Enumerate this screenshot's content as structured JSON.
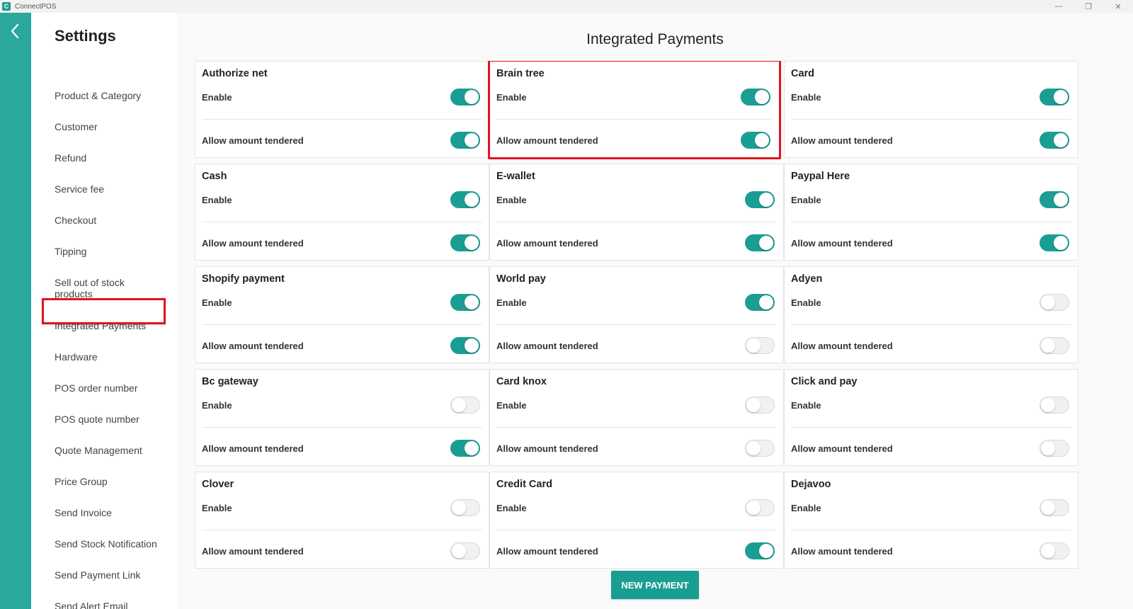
{
  "window": {
    "app_title": "ConnectPOS",
    "app_icon_letter": "C",
    "minimize": "—",
    "restore": "❐",
    "close": "✕"
  },
  "sidebar": {
    "title": "Settings",
    "items": [
      {
        "label": "Product & Category"
      },
      {
        "label": "Customer"
      },
      {
        "label": "Refund"
      },
      {
        "label": "Service fee"
      },
      {
        "label": "Checkout"
      },
      {
        "label": "Tipping"
      },
      {
        "label": "Sell out of stock products"
      },
      {
        "label": "Integrated Payments",
        "active": true
      },
      {
        "label": "Hardware"
      },
      {
        "label": "POS order number"
      },
      {
        "label": "POS quote number"
      },
      {
        "label": "Quote Management"
      },
      {
        "label": "Price Group"
      },
      {
        "label": "Send Invoice"
      },
      {
        "label": "Send Stock Notification"
      },
      {
        "label": "Send Payment Link"
      },
      {
        "label": "Send Alert Email"
      }
    ]
  },
  "main": {
    "title": "Integrated Payments",
    "enable_label": "Enable",
    "tendered_label": "Allow amount tendered",
    "payments": [
      {
        "name": "Authorize net",
        "enable": true,
        "tendered": true
      },
      {
        "name": "Brain tree",
        "enable": true,
        "tendered": true,
        "highlighted": true
      },
      {
        "name": "Card",
        "enable": true,
        "tendered": true
      },
      {
        "name": "Cash",
        "enable": true,
        "tendered": true
      },
      {
        "name": "E-wallet",
        "enable": true,
        "tendered": true
      },
      {
        "name": "Paypal Here",
        "enable": true,
        "tendered": true
      },
      {
        "name": "Shopify payment",
        "enable": true,
        "tendered": true
      },
      {
        "name": "World pay",
        "enable": true,
        "tendered": false
      },
      {
        "name": "Adyen",
        "enable": false,
        "tendered": false
      },
      {
        "name": "Bc gateway",
        "enable": false,
        "tendered": true
      },
      {
        "name": "Card knox",
        "enable": false,
        "tendered": false
      },
      {
        "name": "Click and pay",
        "enable": false,
        "tendered": false
      },
      {
        "name": "Clover",
        "enable": false,
        "tendered": false
      },
      {
        "name": "Credit Card",
        "enable": false,
        "tendered": true
      },
      {
        "name": "Dejavoo",
        "enable": false,
        "tendered": false
      }
    ],
    "new_payment_label": "NEW PAYMENT"
  },
  "colors": {
    "accent": "#1a9e93",
    "rail": "#2aa89b",
    "highlight": "#e0141e"
  }
}
